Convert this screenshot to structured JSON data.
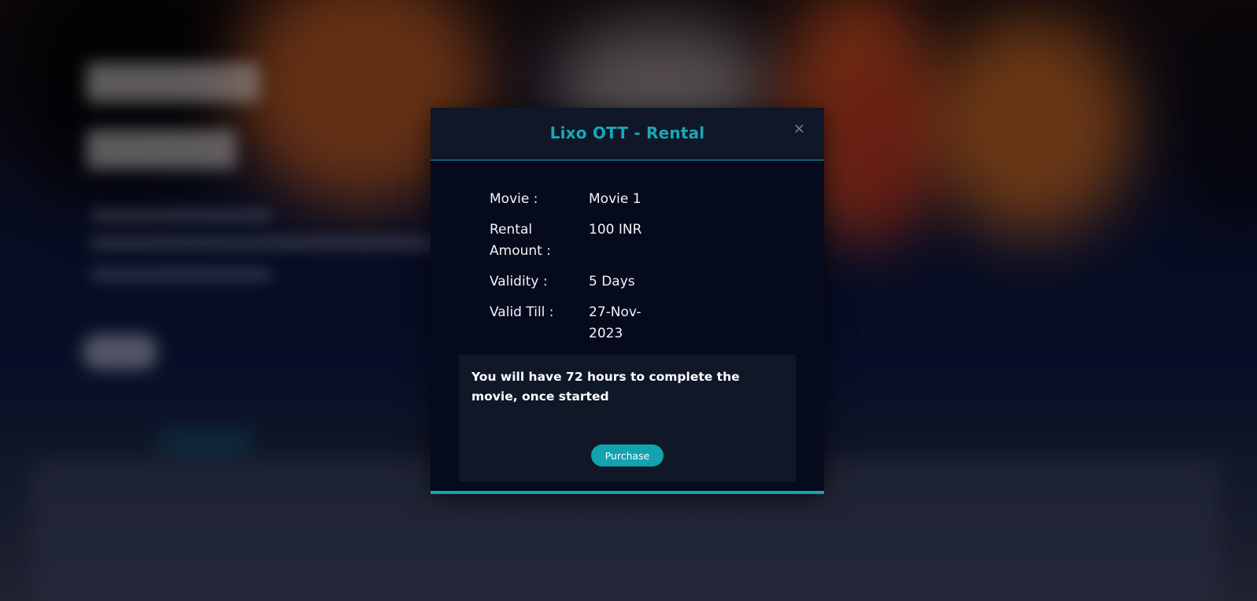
{
  "modal": {
    "title": "Lixo OTT - Rental",
    "close_label": "×",
    "details": [
      {
        "label": "Movie :",
        "value": "Movie 1"
      },
      {
        "label": "Rental Amount :",
        "value": "100 INR"
      },
      {
        "label": "Validity :",
        "value": "5 Days"
      },
      {
        "label": "Valid Till :",
        "value": "27-Nov-2023"
      }
    ],
    "notice": "You will have 72 hours to complete the movie, once started",
    "purchase_label": "Purchase"
  },
  "colors": {
    "accent": "#14a3b3",
    "modal_bg": "#050b1c",
    "header_bg": "#0f1728",
    "notice_bg": "#101726"
  }
}
